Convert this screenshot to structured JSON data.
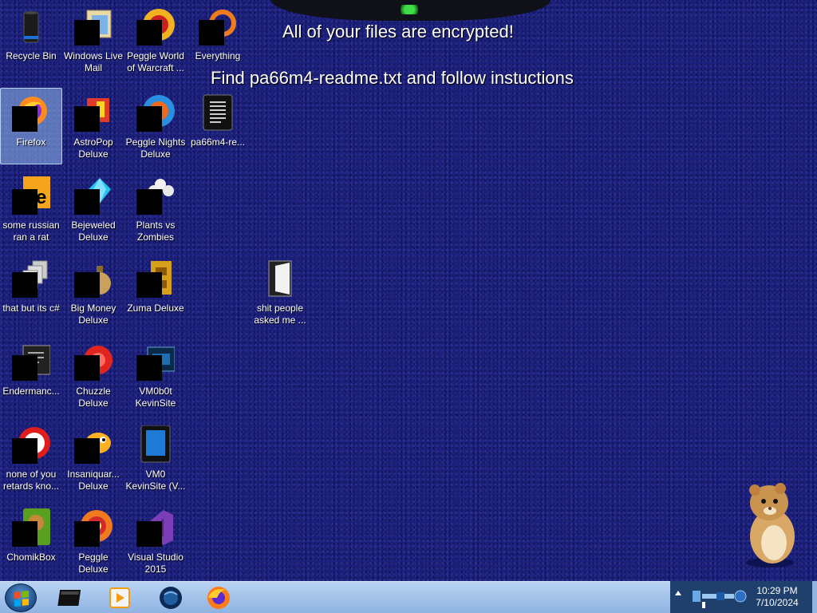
{
  "messages": {
    "line1": "All of your files are encrypted!",
    "line2": "Find pa66m4-readme.txt and follow instuctions"
  },
  "desktop_icons": {
    "recycle_bin": "Recycle Bin",
    "windows_live_mail": "Windows Live Mail",
    "peggle_world": "Peggle World of Warcraft ...",
    "everything": "Everything",
    "firefox": "Firefox",
    "astropop": "AstroPop Deluxe",
    "peggle_nights": "Peggle Nights Deluxe",
    "readme": "pa66m4-re...",
    "some_russian": "some russian ran a rat",
    "bejeweled": "Bejeweled Deluxe",
    "plants_vs_zombies": "Plants vs Zombies",
    "that_but_its_csharp": "that but its c#",
    "big_money": "Big Money Deluxe",
    "zuma": "Zuma Deluxe",
    "shit_people": "shit people asked me ...",
    "endermanch": "Endermanc...",
    "chuzzle": "Chuzzle Deluxe",
    "vm0b0t": "VM0b0t KevinSite",
    "none_of_you": "none of you retards kno...",
    "insaniquarium": "Insaniquar... Deluxe",
    "vm0_kevinsite": "VM0 KevinSite (V...",
    "chomikbox": "ChomikBox",
    "peggle_deluxe": "Peggle Deluxe",
    "visual_studio": "Visual Studio 2015"
  },
  "selected_icon": "Firefox",
  "taskbar": {
    "pinned_icons": [
      "terminal-icon",
      "media-player-icon",
      "globe-icon",
      "firefox-icon"
    ],
    "clock_time": "10:29 PM",
    "clock_date": "7/10/2024"
  },
  "colors": {
    "desktop_background": "#1a1f7a",
    "taskbar": "#a9c6ec",
    "selection": "#96bef0"
  }
}
